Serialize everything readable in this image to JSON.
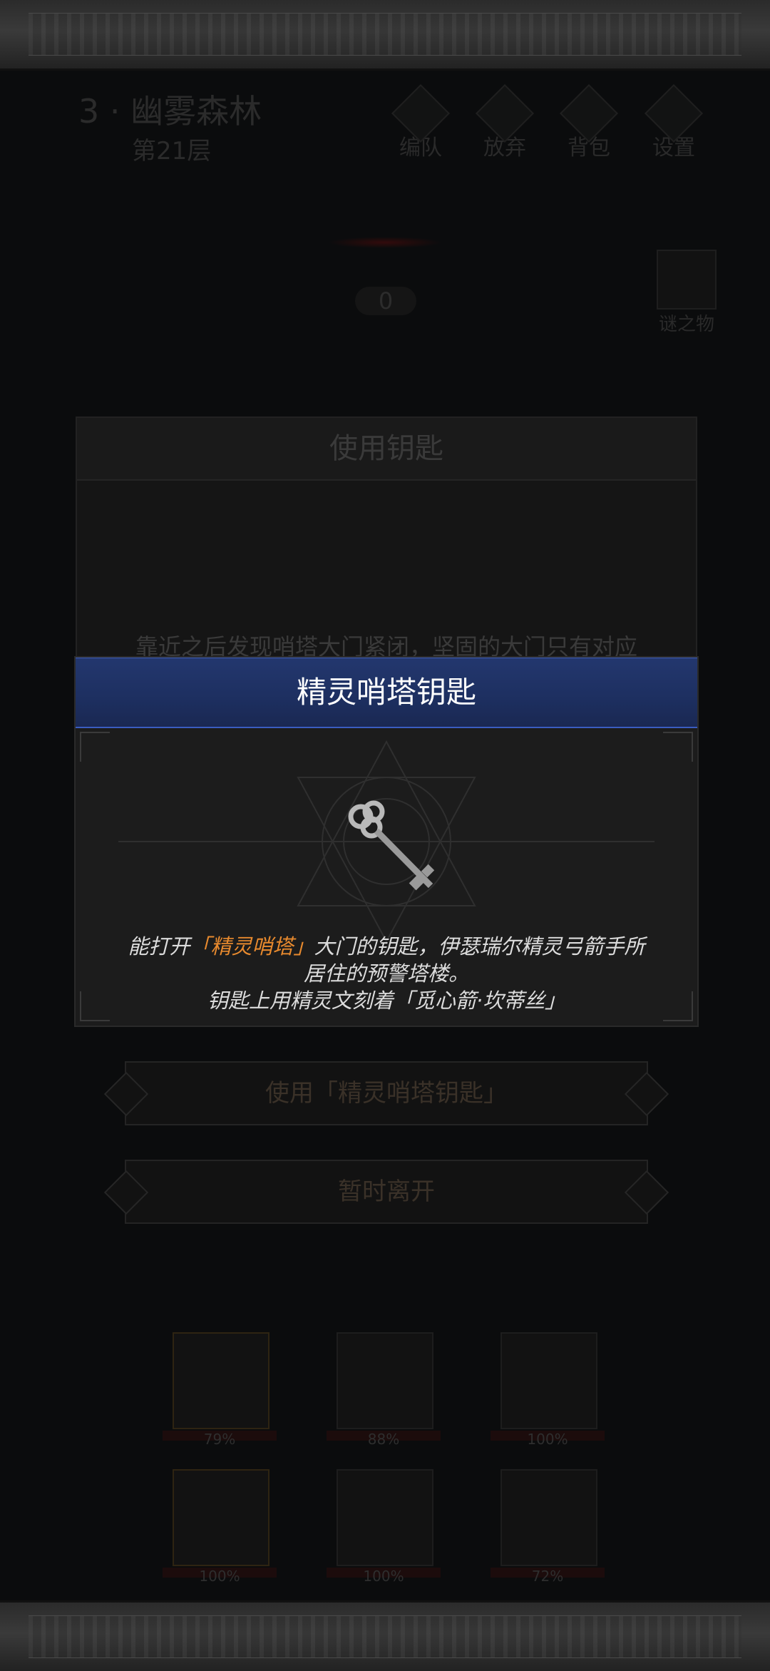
{
  "header": {
    "stage_title": "3 · 幽雾森林",
    "floor": "第21层",
    "buttons": [
      {
        "label": "编队",
        "icon": "team-icon"
      },
      {
        "label": "放弃",
        "icon": "flag-icon"
      },
      {
        "label": "背包",
        "icon": "backpack-icon"
      },
      {
        "label": "设置",
        "icon": "gear-icon"
      }
    ]
  },
  "counter": "0",
  "mystery_item": {
    "label": "谜之物",
    "icon": "question-icon"
  },
  "back_dialog": {
    "title": "使用钥匙",
    "text": "靠近之后发现哨塔大门紧闭，坚固的大门只有对应",
    "options": [
      {
        "label": "使用「精灵哨塔钥匙」"
      },
      {
        "label": "暂时离开"
      }
    ]
  },
  "item_popup": {
    "title": "精灵哨塔钥匙",
    "icon": "key-icon",
    "desc_prefix": "能打开",
    "desc_highlight": "「精灵哨塔」",
    "desc_line1_rest": "大门的钥匙，伊瑟瑞尔精灵弓箭手所",
    "desc_line2": "居住的预警塔楼。",
    "desc_line3": "钥匙上用精灵文刻着「觅心箭·坎蒂丝」"
  },
  "heroes": [
    {
      "hp": "79%"
    },
    {
      "hp": "88%"
    },
    {
      "hp": "100%"
    },
    {
      "hp": "100%"
    },
    {
      "hp": "100%"
    },
    {
      "hp": "72%"
    }
  ],
  "colors": {
    "highlight": "#e88a2e",
    "header_blue": "#1d2f60"
  }
}
